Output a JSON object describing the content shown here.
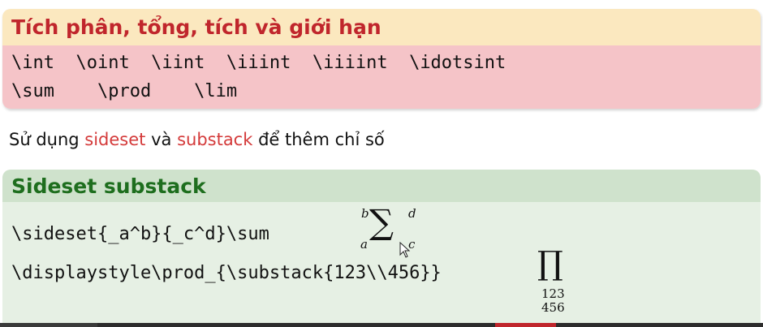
{
  "block1": {
    "title": "Tích phân, tổng, tích và giới hạn",
    "row1": "\\int  \\oint  \\iint  \\iiint  \\iiiint  \\idotsint",
    "row2": "\\sum    \\prod    \\lim"
  },
  "sentence": {
    "part1": "Sử dụng ",
    "link1": "sideset",
    "part2": " và ",
    "link2": "substack",
    "part3": " để thêm chỉ số"
  },
  "block2": {
    "title": "Sideset substack",
    "code1": "\\sideset{_a^b}{_c^d}\\sum",
    "code2": "\\displaystyle\\prod_{\\substack{123\\\\456}}",
    "sum_symbol": "∑",
    "sum_b": "b",
    "sum_a": "a",
    "sum_c": "c",
    "sum_d": "d",
    "prod_symbol": "∏",
    "prod_sub1": "123",
    "prod_sub2": "456"
  },
  "colors": {
    "block1_title": "#c0262c",
    "block1_head_bg": "#fbe8bf",
    "block1_body_bg": "#f5c4c8",
    "block2_title": "#1e6e1e",
    "block2_head_bg": "#cfe2cc",
    "block2_body_bg": "#e6f0e4",
    "accent": "#d43a3a"
  },
  "icons": [
    "mouse-cursor-icon"
  ]
}
